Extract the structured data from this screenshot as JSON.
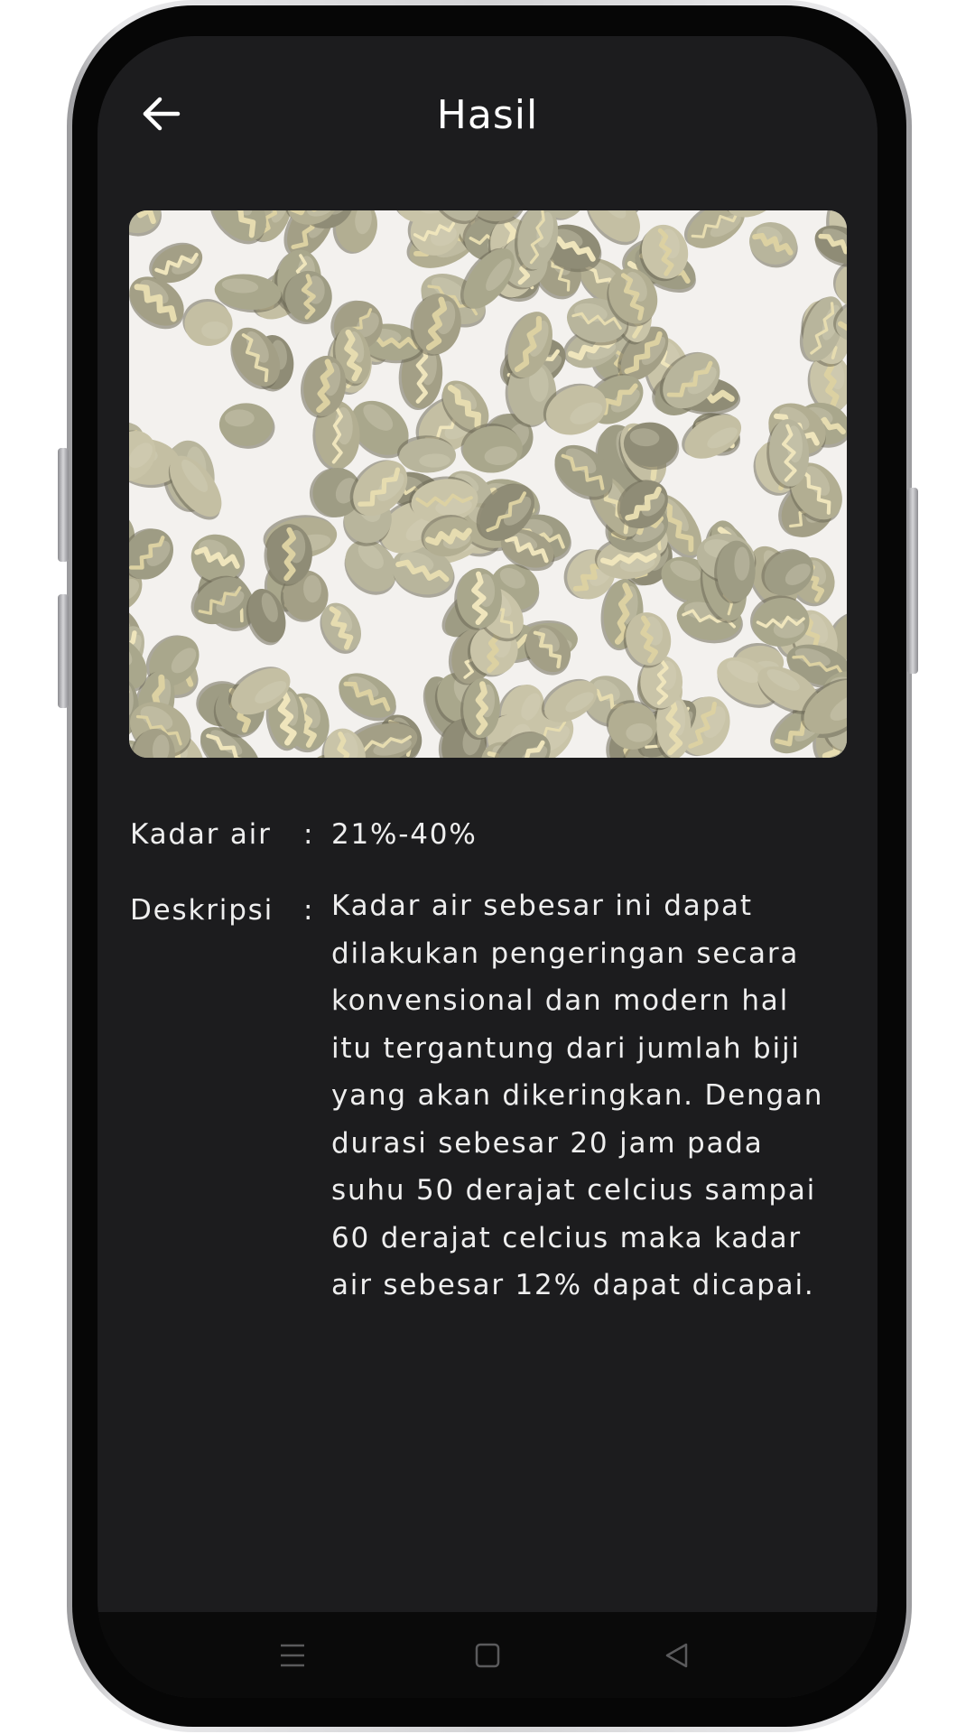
{
  "app_bar": {
    "title": "Hasil",
    "back_icon": "arrow-left-icon"
  },
  "result": {
    "image_alt": "coffee-beans-photo",
    "moisture_label": "Kadar air",
    "moisture_value": "21%-40%",
    "description_label": "Deskripsi",
    "separator": ":",
    "description_text": "Kadar air sebesar ini dapat dilakukan pengeringan secara konvensional dan modern hal itu tergantung dari jumlah biji yang akan dikeringkan. Dengan durasi sebesar 20 jam pada suhu 50 derajat celcius sampai 60 derajat celcius maka kadar air sebesar 12% dapat dicapai."
  },
  "nav_bar": {
    "menu_icon": "menu-icon",
    "home_icon": "home-square-icon",
    "back_icon": "back-triangle-icon"
  },
  "colors": {
    "screen_bg": "#1c1c1e",
    "text": "#eeeeee",
    "nav_bg": "#0a0a0a",
    "nav_icon": "#5a5a5c"
  }
}
